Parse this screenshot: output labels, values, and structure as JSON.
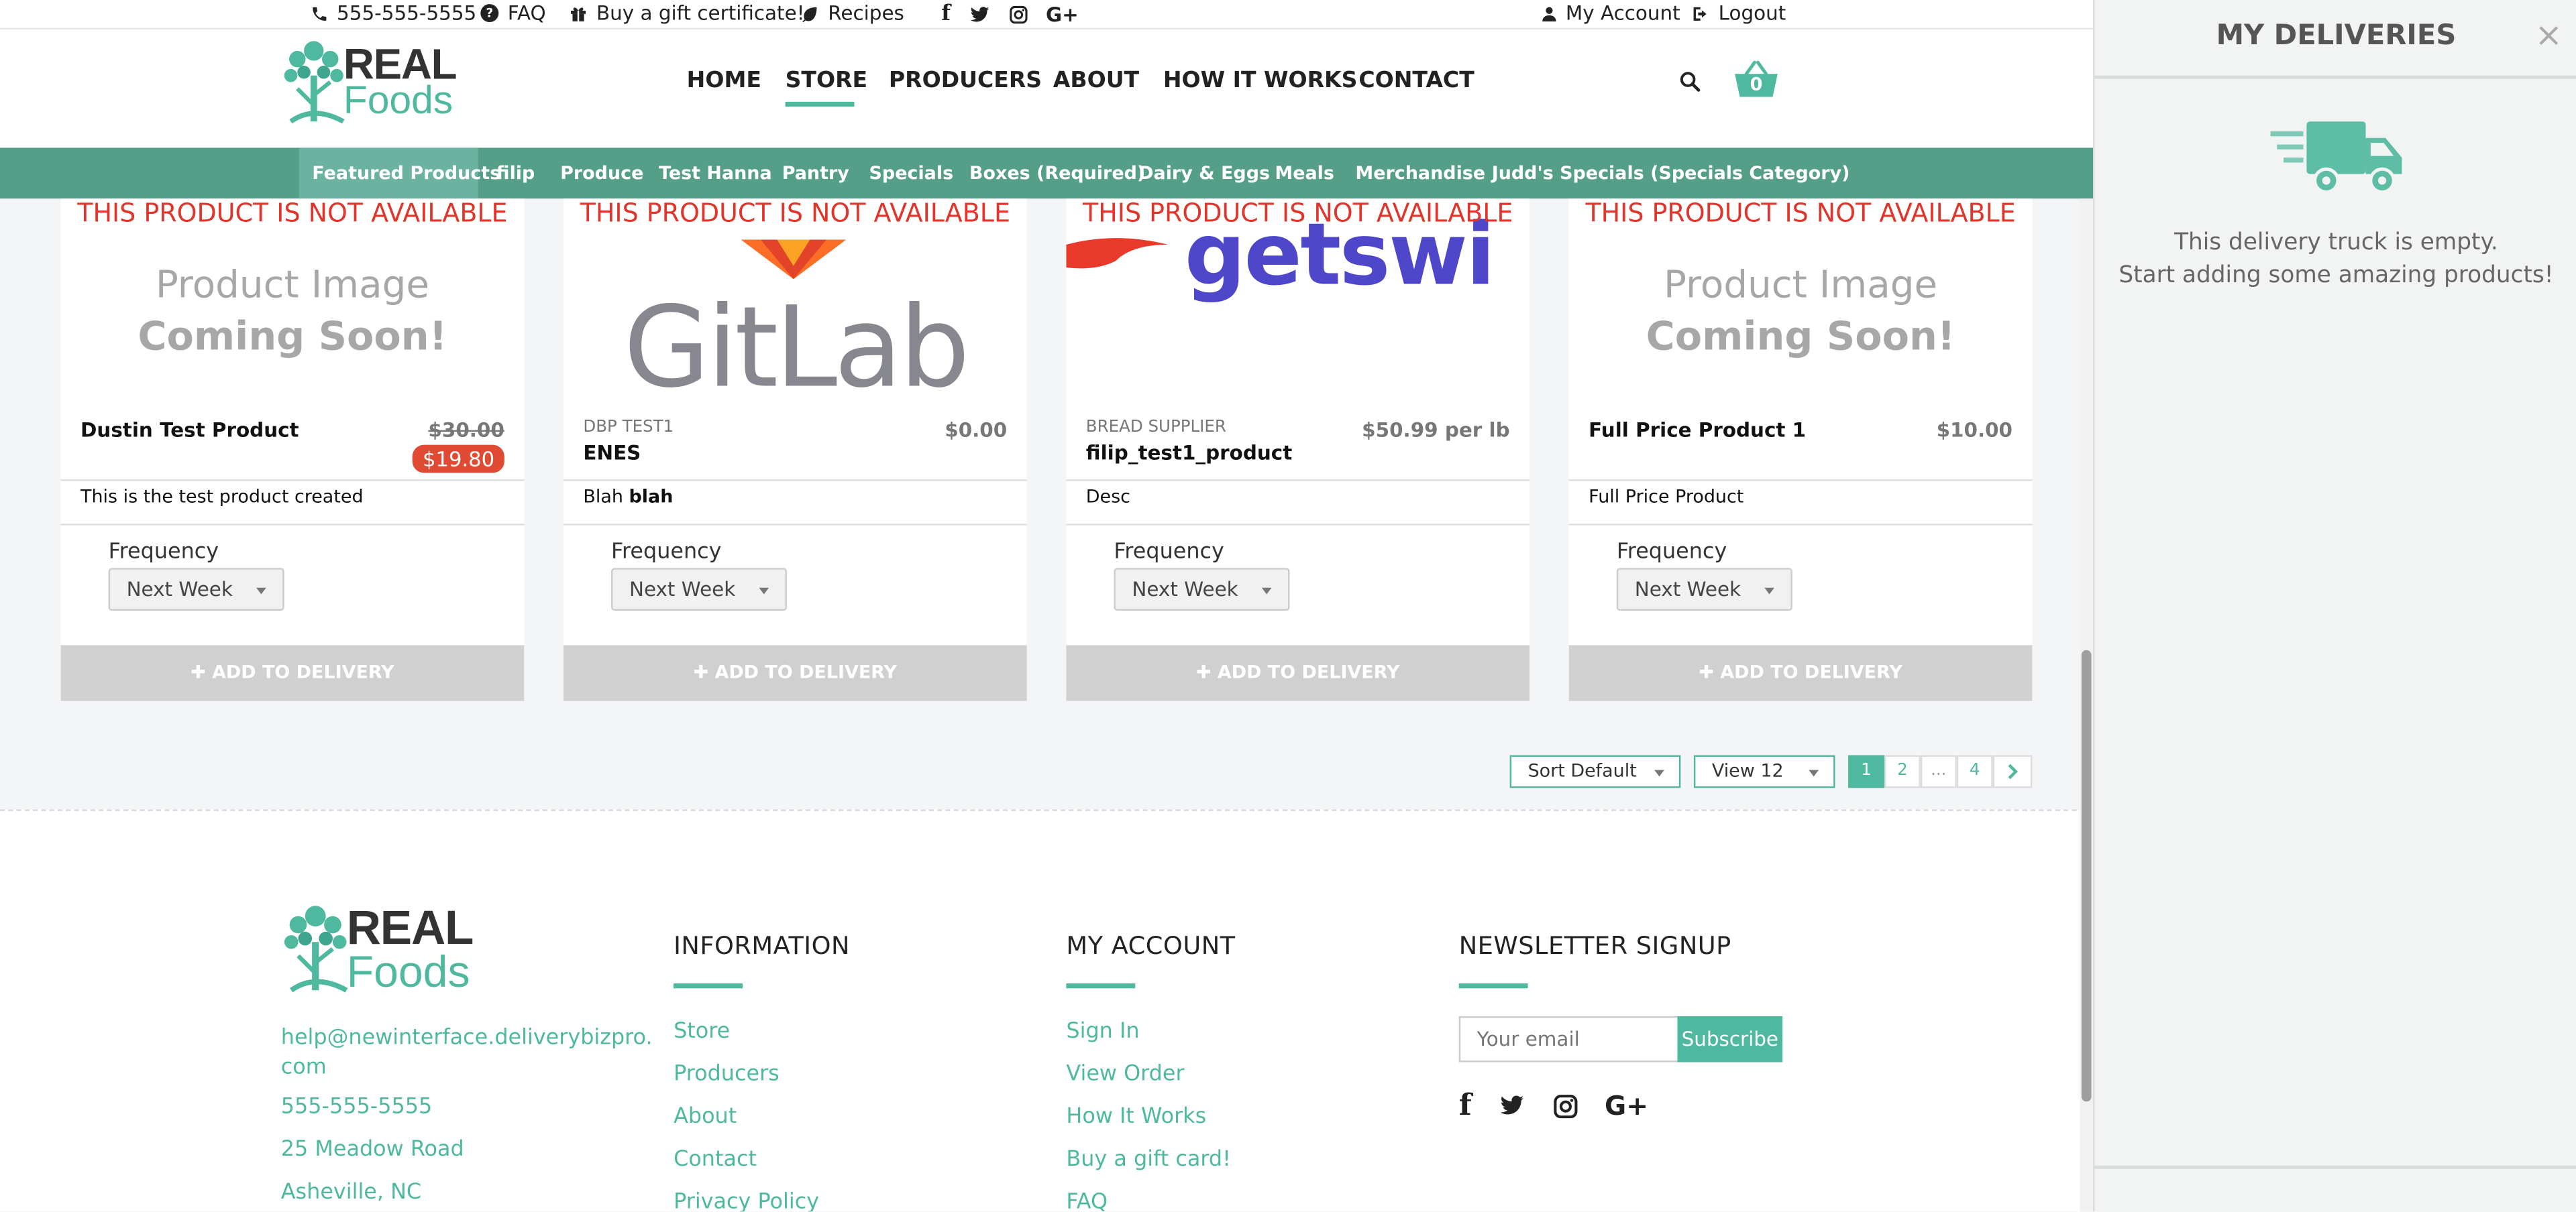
{
  "topbar": {
    "phone": "555-555-5555",
    "faq": "FAQ",
    "gift": "Buy a gift certificate!",
    "recipes": "Recipes",
    "my_account": "My Account",
    "logout": "Logout"
  },
  "brand": {
    "line1": "REAL",
    "line2": "Foods"
  },
  "nav": {
    "items": [
      "HOME",
      "STORE",
      "PRODUCERS",
      "ABOUT",
      "HOW IT WORKS",
      "CONTACT"
    ],
    "active": "STORE",
    "cart_count": "0"
  },
  "categories": {
    "items": [
      "Featured Products",
      "filip",
      "Produce",
      "Test Hanna",
      "Pantry",
      "Specials",
      "Boxes (Required)",
      "Dairy & Eggs",
      "Meals",
      "Merchandise",
      "Judd's Specials (Specials Category)"
    ],
    "active": "Featured Products"
  },
  "products": [
    {
      "not_available": "THIS PRODUCT IS NOT AVAILABLE",
      "image_line1": "Product Image",
      "image_line2": "Coming Soon!",
      "supplier": "",
      "name": "Dustin Test Product",
      "old_price": "$30.00",
      "sale_price": "$19.80",
      "description": "This is the test product created",
      "frequency_label": "Frequency",
      "frequency_value": "Next Week",
      "add_button": "ADD TO DELIVERY"
    },
    {
      "not_available": "THIS PRODUCT IS NOT AVAILABLE",
      "image_text": "GitLab",
      "supplier": "DBP TEST1",
      "name": "ENES",
      "price": "$0.00",
      "description_plain": "Blah ",
      "description_bold": "blah",
      "frequency_label": "Frequency",
      "frequency_value": "Next Week",
      "add_button": "ADD TO DELIVERY"
    },
    {
      "not_available": "THIS PRODUCT IS NOT AVAILABLE",
      "image_text": "getswi",
      "supplier": "BREAD SUPPLIER",
      "name": "filip_test1_product",
      "price": "$50.99 per lb",
      "description": "Desc",
      "frequency_label": "Frequency",
      "frequency_value": "Next Week",
      "add_button": "ADD TO DELIVERY"
    },
    {
      "not_available": "THIS PRODUCT IS NOT AVAILABLE",
      "image_line1": "Product Image",
      "image_line2": "Coming Soon!",
      "supplier": "",
      "name": "Full Price Product 1",
      "price": "$10.00",
      "description": "Full Price Product",
      "frequency_label": "Frequency",
      "frequency_value": "Next Week",
      "add_button": "ADD TO DELIVERY"
    }
  ],
  "listing": {
    "sort": "Sort Default",
    "view": "View 12",
    "pages": [
      "1",
      "2",
      "...",
      "4"
    ],
    "current_page": "1"
  },
  "footer": {
    "email": "help@newinterface.deliverybizpro.com",
    "email_line1": "help@newinterface.deliverybizpro.",
    "email_line2": "com",
    "phone": "555-555-5555",
    "address": "25 Meadow Road",
    "city": "Asheville, NC",
    "information": {
      "title": "INFORMATION",
      "links": [
        "Store",
        "Producers",
        "About",
        "Contact",
        "Privacy Policy"
      ]
    },
    "my_account": {
      "title": "MY ACCOUNT",
      "links": [
        "Sign In",
        "View Order",
        "How It Works",
        "Buy a gift card!",
        "FAQ"
      ]
    },
    "newsletter": {
      "title": "NEWSLETTER SIGNUP",
      "placeholder": "Your email",
      "button": "Subscribe"
    }
  },
  "panel": {
    "title": "MY DELIVERIES",
    "close": "×",
    "empty_line1": "This delivery truck is empty.",
    "empty_line2": "Start adding some amazing products!"
  },
  "colors": {
    "accent": "#4fb9a0",
    "category_bar": "#559e87",
    "unavailable": "#e0352b",
    "sale_badge": "#e14a32"
  }
}
